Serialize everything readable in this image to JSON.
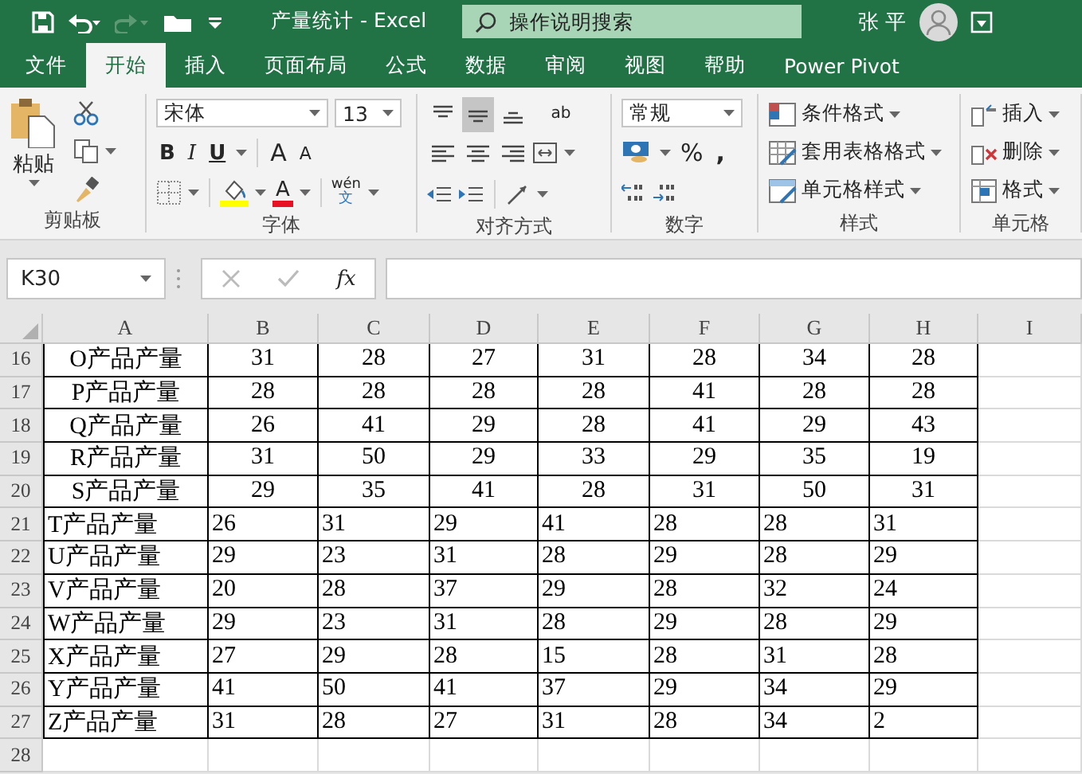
{
  "title_bar": {
    "title": "产量统计  -  Excel",
    "search_placeholder": "操作说明搜索",
    "user": "张 平"
  },
  "menu_tabs": [
    {
      "label": "文件",
      "selected": false
    },
    {
      "label": "开始",
      "selected": true
    },
    {
      "label": "插入",
      "selected": false
    },
    {
      "label": "页面布局",
      "selected": false
    },
    {
      "label": "公式",
      "selected": false
    },
    {
      "label": "数据",
      "selected": false
    },
    {
      "label": "审阅",
      "selected": false
    },
    {
      "label": "视图",
      "selected": false
    },
    {
      "label": "帮助",
      "selected": false
    },
    {
      "label": "Power Pivot",
      "selected": false
    }
  ],
  "ribbon": {
    "clipboard": {
      "paste": "粘贴",
      "label": "剪贴板"
    },
    "font": {
      "font_name": "宋体",
      "font_size": "13",
      "bold": "B",
      "italic": "I",
      "underline": "U",
      "grow": "A",
      "shrink": "A",
      "font_color": "A",
      "phonetic_top": "wén",
      "phonetic_bottom": "文",
      "label": "字体"
    },
    "alignment": {
      "align_buttons": [
        {
          "kind": "top",
          "selected": false
        },
        {
          "kind": "middle",
          "selected": true
        },
        {
          "kind": "bottom",
          "selected": false
        },
        {
          "kind": "left",
          "selected": false
        },
        {
          "kind": "center",
          "selected": false
        },
        {
          "kind": "right",
          "selected": false
        }
      ],
      "wrap": "ab",
      "label": "对齐方式"
    },
    "number": {
      "format": "常规",
      "percent": "%",
      "comma": ",",
      "label": "数字"
    },
    "styles": {
      "items": [
        "条件格式",
        "套用表格格式",
        "单元格样式"
      ],
      "label": "样式"
    },
    "cells": {
      "items": [
        "插入",
        "删除",
        "格式"
      ],
      "label": "单元格"
    }
  },
  "formula_bar": {
    "name_box": "K30",
    "fx": "fx"
  },
  "sheet": {
    "columns": [
      "A",
      "B",
      "C",
      "D",
      "E",
      "F",
      "G",
      "H",
      "I"
    ],
    "rows": [
      {
        "number": "16",
        "kind": "centered",
        "cells": [
          "O产品产量",
          "31",
          "28",
          "27",
          "31",
          "28",
          "34",
          "28"
        ]
      },
      {
        "number": "17",
        "kind": "centered",
        "cells": [
          "P产品产量",
          "28",
          "28",
          "28",
          "28",
          "41",
          "28",
          "28"
        ]
      },
      {
        "number": "18",
        "kind": "centered",
        "cells": [
          "Q产品产量",
          "26",
          "41",
          "29",
          "28",
          "41",
          "29",
          "43"
        ]
      },
      {
        "number": "19",
        "kind": "centered",
        "cells": [
          "R产品产量",
          "31",
          "50",
          "29",
          "33",
          "29",
          "35",
          "19"
        ]
      },
      {
        "number": "20",
        "kind": "centered",
        "cells": [
          "S产品产量",
          "29",
          "35",
          "41",
          "28",
          "31",
          "50",
          "31"
        ]
      },
      {
        "number": "21",
        "kind": "left",
        "cells": [
          "T产品产量",
          "26",
          "31",
          "29",
          "41",
          "28",
          "28",
          "31"
        ]
      },
      {
        "number": "22",
        "kind": "left",
        "cells": [
          "U产品产量",
          "29",
          "23",
          "31",
          "28",
          "29",
          "28",
          "29"
        ]
      },
      {
        "number": "23",
        "kind": "left",
        "cells": [
          "V产品产量",
          "20",
          "28",
          "37",
          "29",
          "28",
          "32",
          "24"
        ]
      },
      {
        "number": "24",
        "kind": "left",
        "cells": [
          "W产品产量",
          "29",
          "23",
          "31",
          "28",
          "29",
          "28",
          "29"
        ]
      },
      {
        "number": "25",
        "kind": "left",
        "cells": [
          "X产品产量",
          "27",
          "29",
          "28",
          "15",
          "28",
          "31",
          "28"
        ]
      },
      {
        "number": "26",
        "kind": "left",
        "cells": [
          "Y产品产量",
          "41",
          "50",
          "41",
          "37",
          "29",
          "34",
          "29"
        ]
      },
      {
        "number": "27",
        "kind": "left",
        "cells": [
          "Z产品产量",
          "31",
          "28",
          "27",
          "31",
          "28",
          "34",
          "2"
        ]
      },
      {
        "number": "28",
        "kind": "empty"
      }
    ]
  }
}
